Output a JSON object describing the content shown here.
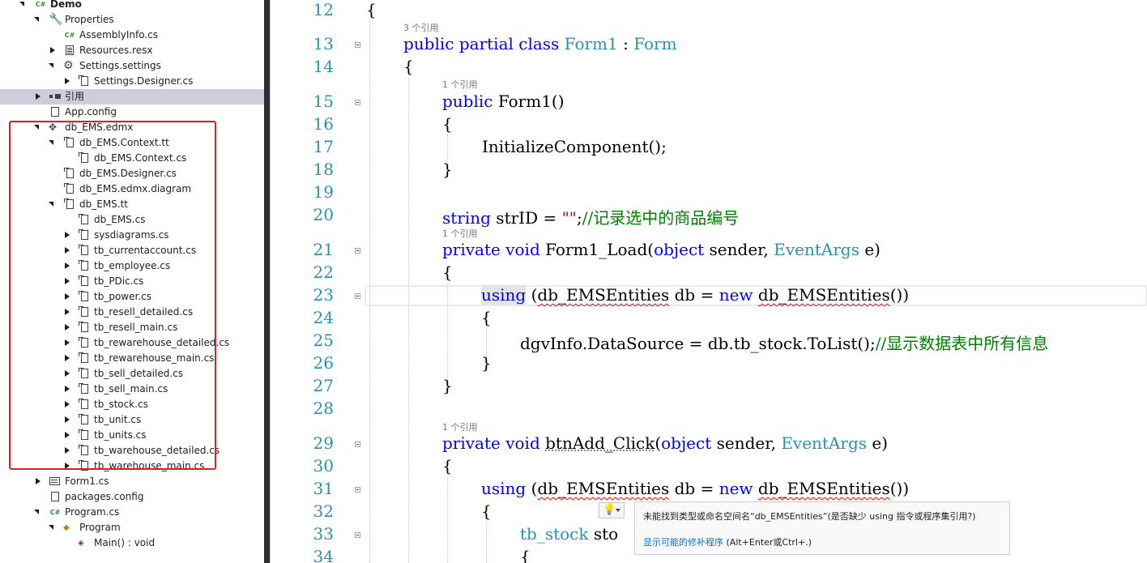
{
  "explorer": {
    "rows": [
      {
        "label": "Demo",
        "icon": "csharp-project-icon",
        "indent": 0,
        "arrow": "expanded",
        "bold": true
      },
      {
        "label": "Properties",
        "icon": "wrench-icon",
        "indent": 1,
        "arrow": "expanded"
      },
      {
        "label": "AssemblyInfo.cs",
        "icon": "csharp-file-icon",
        "indent": 2,
        "arrow": "none"
      },
      {
        "label": "Resources.resx",
        "icon": "resx-file-icon",
        "indent": 2,
        "arrow": "collapsed"
      },
      {
        "label": "Settings.settings",
        "icon": "gear-icon",
        "indent": 2,
        "arrow": "expanded"
      },
      {
        "label": "Settings.Designer.cs",
        "icon": "code-file-icon",
        "indent": 3,
        "arrow": "collapsed"
      },
      {
        "label": "引用",
        "icon": "references-icon",
        "indent": 1,
        "arrow": "collapsed",
        "selected": true
      },
      {
        "label": "App.config",
        "icon": "config-file-icon",
        "indent": 1,
        "arrow": "none"
      },
      {
        "label": "db_EMS.edmx",
        "icon": "edmx-model-icon",
        "indent": 1,
        "arrow": "expanded"
      },
      {
        "label": "db_EMS.Context.tt",
        "icon": "template-file-icon",
        "indent": 2,
        "arrow": "expanded"
      },
      {
        "label": "db_EMS.Context.cs",
        "icon": "code-file-icon",
        "indent": 3,
        "arrow": "none"
      },
      {
        "label": "db_EMS.Designer.cs",
        "icon": "code-file-icon",
        "indent": 2,
        "arrow": "none"
      },
      {
        "label": "db_EMS.edmx.diagram",
        "icon": "code-file-icon",
        "indent": 2,
        "arrow": "none"
      },
      {
        "label": "db_EMS.tt",
        "icon": "template-file-icon",
        "indent": 2,
        "arrow": "expanded"
      },
      {
        "label": "db_EMS.cs",
        "icon": "code-file-icon",
        "indent": 3,
        "arrow": "none"
      },
      {
        "label": "sysdiagrams.cs",
        "icon": "code-file-icon",
        "indent": 3,
        "arrow": "collapsed"
      },
      {
        "label": "tb_currentaccount.cs",
        "icon": "code-file-icon",
        "indent": 3,
        "arrow": "collapsed"
      },
      {
        "label": "tb_employee.cs",
        "icon": "code-file-icon",
        "indent": 3,
        "arrow": "collapsed"
      },
      {
        "label": "tb_PDic.cs",
        "icon": "code-file-icon",
        "indent": 3,
        "arrow": "collapsed"
      },
      {
        "label": "tb_power.cs",
        "icon": "code-file-icon",
        "indent": 3,
        "arrow": "collapsed"
      },
      {
        "label": "tb_resell_detailed.cs",
        "icon": "code-file-icon",
        "indent": 3,
        "arrow": "collapsed"
      },
      {
        "label": "tb_resell_main.cs",
        "icon": "code-file-icon",
        "indent": 3,
        "arrow": "collapsed"
      },
      {
        "label": "tb_rewarehouse_detailed.cs",
        "icon": "code-file-icon",
        "indent": 3,
        "arrow": "collapsed"
      },
      {
        "label": "tb_rewarehouse_main.cs",
        "icon": "code-file-icon",
        "indent": 3,
        "arrow": "collapsed"
      },
      {
        "label": "tb_sell_detailed.cs",
        "icon": "code-file-icon",
        "indent": 3,
        "arrow": "collapsed"
      },
      {
        "label": "tb_sell_main.cs",
        "icon": "code-file-icon",
        "indent": 3,
        "arrow": "collapsed"
      },
      {
        "label": "tb_stock.cs",
        "icon": "code-file-icon",
        "indent": 3,
        "arrow": "collapsed"
      },
      {
        "label": "tb_unit.cs",
        "icon": "code-file-icon",
        "indent": 3,
        "arrow": "collapsed"
      },
      {
        "label": "tb_units.cs",
        "icon": "code-file-icon",
        "indent": 3,
        "arrow": "collapsed"
      },
      {
        "label": "tb_warehouse_detailed.cs",
        "icon": "code-file-icon",
        "indent": 3,
        "arrow": "collapsed"
      },
      {
        "label": "tb_warehouse_main.cs",
        "icon": "code-file-icon",
        "indent": 3,
        "arrow": "collapsed"
      },
      {
        "label": "Form1.cs",
        "icon": "form-icon",
        "indent": 1,
        "arrow": "collapsed"
      },
      {
        "label": "packages.config",
        "icon": "config-file-icon",
        "indent": 1,
        "arrow": "none"
      },
      {
        "label": "Program.cs",
        "icon": "csharp-file-icon",
        "indent": 1,
        "arrow": "expanded"
      },
      {
        "label": "Program",
        "icon": "class-icon",
        "indent": 2,
        "arrow": "expanded"
      },
      {
        "label": "Main() : void",
        "icon": "method-icon",
        "indent": 3,
        "arrow": "none"
      }
    ]
  },
  "editor": {
    "lines": [
      {
        "num": "12"
      },
      {
        "num": "13"
      },
      {
        "num": "14"
      },
      {
        "num": "15"
      },
      {
        "num": "16"
      },
      {
        "num": "17"
      },
      {
        "num": "18"
      },
      {
        "num": "19"
      },
      {
        "num": "20"
      },
      {
        "num": "21"
      },
      {
        "num": "22"
      },
      {
        "num": "23"
      },
      {
        "num": "24"
      },
      {
        "num": "25"
      },
      {
        "num": "26"
      },
      {
        "num": "27"
      },
      {
        "num": "28"
      },
      {
        "num": "29"
      },
      {
        "num": "30"
      },
      {
        "num": "31"
      },
      {
        "num": "32"
      },
      {
        "num": "33"
      },
      {
        "num": "34"
      }
    ],
    "lens": {
      "class_refs": "3 个引用",
      "ctor_refs": "1 个引用",
      "load_refs": "1 个引用",
      "add_refs": "1 个引用"
    },
    "code": {
      "l12": "{",
      "l13_public": "public",
      "l13_partial": "partial",
      "l13_class": "class",
      "l13_name": "Form1",
      "l13_colon": " : ",
      "l13_base": "Form",
      "l14": "{",
      "l15_public": "public",
      "l15_rest": " Form1()",
      "l16": "{",
      "l17": "InitializeComponent();",
      "l18": "}",
      "l20_string": "string",
      "l20_mid": " strID = ",
      "l20_str": "\"\"",
      "l20_end": ";",
      "l20_comment": "//记录选中的商品编号",
      "l21_private": "private",
      "l21_void": "void",
      "l21_name": " Form1_Load(",
      "l21_object": "object",
      "l21_sender": " sender, ",
      "l21_eventargs": "EventArgs",
      "l21_end": " e)",
      "l22": "{",
      "l23_using": "using",
      "l23_open": " (",
      "l23_type": "db_EMSEntities",
      "l23_mid": " db = ",
      "l23_new": "new",
      "l23_sp": " ",
      "l23_type2": "db_EMSEntities",
      "l23_end": "())",
      "l24": "{",
      "l25_code": "dgvInfo.DataSource = db.tb_stock.ToList();",
      "l25_comment": "//显示数据表中所有信息",
      "l26": "}",
      "l27": "}",
      "l29_private": "private",
      "l29_void": "void",
      "l29_name": "btnAdd_Click",
      "l29_open": "(",
      "l29_object": "object",
      "l29_sender": " sender, ",
      "l29_eventargs": "EventArgs",
      "l29_end": " e)",
      "l30": "{",
      "l31_using": "using",
      "l31_open": " (",
      "l31_type": "db_EMSEntities",
      "l31_mid": " db = ",
      "l31_new": "new",
      "l31_sp": " ",
      "l31_type2": "db_EMSEntities",
      "l31_end": "())",
      "l32": "{",
      "l33_type": "tb_stock",
      "l33_rest": " sto",
      "l34": "{"
    }
  },
  "quick_actions": {
    "icon": "lightbulb-icon"
  },
  "error_tooltip": {
    "message": "未能找到类型或命名空间名“db_EMSEntities”(是否缺少 using 指令或程序集引用?)",
    "fix_link": "显示可能的修补程序",
    "shortcut": " (Alt+Enter或Ctrl+.)"
  },
  "colors": {
    "keyword": "#0000ff",
    "type": "#2b91af",
    "comment": "#008000",
    "string": "#a31515",
    "highlight_box": "#e02020"
  }
}
